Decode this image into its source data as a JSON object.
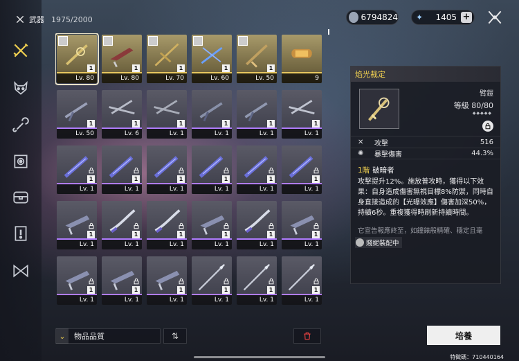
{
  "header": {
    "section_label": "武器",
    "count_text": "1975/2000"
  },
  "currencies": {
    "coins": "6794824",
    "crystals": "1405"
  },
  "left_rail": {
    "items": [
      "swords-icon",
      "demon-mask-icon",
      "wrench-icon",
      "gear-chip-icon",
      "chest-icon",
      "alert-card-icon",
      "bowtie-icon"
    ]
  },
  "grid": {
    "cells": [
      {
        "lv": "Lv. 80",
        "qty": "1",
        "lock": false,
        "avatar": true,
        "tier": "gold",
        "selected": true
      },
      {
        "lv": "Lv. 80",
        "qty": "1",
        "lock": false,
        "avatar": true,
        "tier": "gold"
      },
      {
        "lv": "Lv. 70",
        "qty": "1",
        "lock": false,
        "avatar": true,
        "tier": "gold"
      },
      {
        "lv": "Lv. 60",
        "qty": "1",
        "lock": false,
        "avatar": true,
        "tier": "gold"
      },
      {
        "lv": "Lv. 50",
        "qty": "1",
        "lock": false,
        "avatar": true,
        "tier": "gold"
      },
      {
        "lv": "9",
        "qty": "",
        "lock": false,
        "avatar": false,
        "tier": "gold"
      },
      {
        "lv": "Lv. 50",
        "qty": "1",
        "lock": false,
        "tier": "purple"
      },
      {
        "lv": "Lv. 6",
        "qty": "1",
        "lock": false,
        "tier": "purple"
      },
      {
        "lv": "Lv. 1",
        "qty": "1",
        "lock": false,
        "tier": "purple"
      },
      {
        "lv": "Lv. 1",
        "qty": "1",
        "lock": false,
        "tier": "purple"
      },
      {
        "lv": "Lv. 1",
        "qty": "1",
        "lock": false,
        "tier": "purple"
      },
      {
        "lv": "Lv. 1",
        "qty": "1",
        "lock": false,
        "tier": "purple"
      },
      {
        "lv": "Lv. 1",
        "qty": "1",
        "lock": true,
        "tier": "purple"
      },
      {
        "lv": "Lv. 1",
        "qty": "1",
        "lock": true,
        "tier": "purple"
      },
      {
        "lv": "Lv. 1",
        "qty": "1",
        "lock": true,
        "tier": "purple"
      },
      {
        "lv": "Lv. 1",
        "qty": "1",
        "lock": true,
        "tier": "purple"
      },
      {
        "lv": "Lv. 1",
        "qty": "1",
        "lock": true,
        "tier": "purple"
      },
      {
        "lv": "Lv. 1",
        "qty": "1",
        "lock": true,
        "tier": "purple"
      },
      {
        "lv": "Lv. 1",
        "qty": "1",
        "lock": true,
        "tier": "purple"
      },
      {
        "lv": "Lv. 1",
        "qty": "1",
        "lock": true,
        "tier": "purple"
      },
      {
        "lv": "Lv. 1",
        "qty": "1",
        "lock": true,
        "tier": "purple"
      },
      {
        "lv": "Lv. 1",
        "qty": "1",
        "lock": true,
        "tier": "purple"
      },
      {
        "lv": "Lv. 1",
        "qty": "1",
        "lock": true,
        "tier": "purple"
      },
      {
        "lv": "Lv. 1",
        "qty": "1",
        "lock": true,
        "tier": "purple"
      },
      {
        "lv": "Lv. 1",
        "qty": "1",
        "lock": true,
        "tier": "purple"
      },
      {
        "lv": "Lv. 1",
        "qty": "1",
        "lock": true,
        "tier": "purple"
      },
      {
        "lv": "Lv. 1",
        "qty": "1",
        "lock": true,
        "tier": "purple"
      },
      {
        "lv": "Lv. 1",
        "qty": "1",
        "lock": true,
        "tier": "purple"
      },
      {
        "lv": "Lv. 1",
        "qty": "1",
        "lock": true,
        "tier": "purple"
      },
      {
        "lv": "Lv. 1",
        "qty": "1",
        "lock": true,
        "tier": "purple"
      }
    ]
  },
  "sort": {
    "label": "物品品質",
    "order_glyph": "⇅"
  },
  "detail": {
    "name": "焰光裁定",
    "type": "臂鎧",
    "level_text": "等級 80/80",
    "stats": [
      {
        "icon": "sword-cross-icon",
        "name": "攻擊",
        "value": "516"
      },
      {
        "icon": "crit-burst-icon",
        "name": "暴擊傷害",
        "value": "44.3%"
      }
    ],
    "skill_tier": "1階",
    "skill_name": "破暗者",
    "skill_desc": "攻擊提升12%。施放普攻時，獲得以下效果：自身造成傷害無視目標8%防禦，同時自身直接造成的【光曝效應】傷害加深50%，持續6秒。重複獲得時刷新持續時間。",
    "lore": "它宣告報應終至，如鐘錶般精確、穩定且毫",
    "equipped_by": "賤妮裝配中"
  },
  "actions": {
    "upgrade": "培養"
  },
  "footer": {
    "uid": "特徵碼：710440164"
  },
  "colors": {
    "accent": "#f0d050",
    "purple_tier": "#b07cff",
    "gold_tier": "#e8c860",
    "trash": "#e04040"
  }
}
